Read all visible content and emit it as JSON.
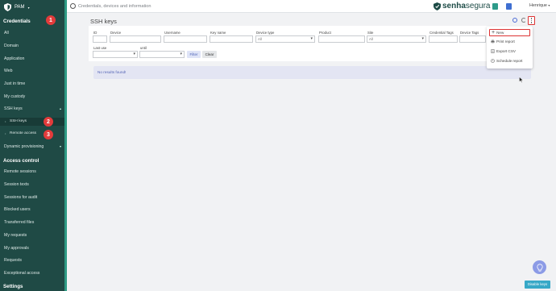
{
  "sidebar": {
    "brand": "PAM",
    "sections": {
      "credentials": "Credentials",
      "access_control": "Access control",
      "settings": "Settings"
    },
    "credentials_items": [
      "All",
      "Domain",
      "Application",
      "Web",
      "Just in time",
      "My custody",
      "SSH keys",
      "SSH keys",
      "Remote access",
      "Dynamic provisioning"
    ],
    "access_items": [
      "Remote sessions",
      "Session texts",
      "Sessions for audit",
      "Blocked users",
      "Transferred files",
      "My requests",
      "My approvals",
      "Requests",
      "Exceptional access"
    ],
    "badges": [
      "1",
      "2",
      "3"
    ]
  },
  "topbar": {
    "search_placeholder": "Credentials, devices and information",
    "logo_main": "senha",
    "logo_light": "segura",
    "user": "Henrique"
  },
  "page": {
    "title": "SSH keys"
  },
  "filters": {
    "labels": [
      "ID",
      "Device",
      "Username",
      "Key name",
      "Device type",
      "Product",
      "Site",
      "Credential Tags",
      "Device Tags",
      "Last use",
      "until"
    ],
    "device_type_value": "All",
    "site_value": "All",
    "filter_label": "Filter",
    "clear_label": "Clear"
  },
  "results": {
    "message": "No results found!"
  },
  "menu": {
    "items": [
      "New",
      "Print report",
      "Export CSV",
      "Schedule report"
    ]
  },
  "footer": {
    "disable_label": "Disable keys"
  },
  "colors": {
    "sidebar": "#1f4a45",
    "accent": "#2d9a83",
    "badge": "#e23b3b",
    "highlight": "#dd3333"
  }
}
